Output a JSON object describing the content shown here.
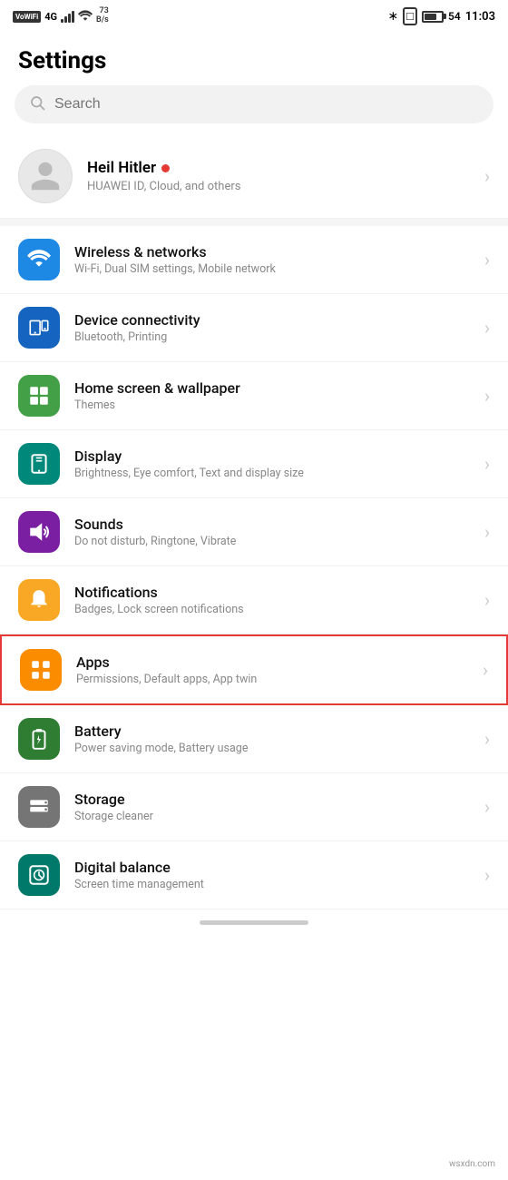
{
  "statusBar": {
    "left": {
      "vowifi": "VoWiFi",
      "network": "4G",
      "signal": "|||",
      "wifi": "WiFi",
      "speed": "73\nB/s"
    },
    "right": {
      "bluetooth": "BT",
      "vibrate": "📳",
      "battery": "54",
      "time": "11:03"
    }
  },
  "page": {
    "title": "Settings"
  },
  "search": {
    "placeholder": "Search"
  },
  "profile": {
    "name": "Heil Hitler",
    "subtitle": "HUAWEI ID, Cloud, and others"
  },
  "settingsItems": [
    {
      "id": "wireless",
      "iconColor": "icon-blue",
      "iconSymbol": "📶",
      "iconUnicode": "wifi",
      "title": "Wireless & networks",
      "subtitle": "Wi-Fi, Dual SIM settings, Mobile network",
      "highlighted": false
    },
    {
      "id": "device-connectivity",
      "iconColor": "icon-blue2",
      "iconSymbol": "🔗",
      "iconUnicode": "device",
      "title": "Device connectivity",
      "subtitle": "Bluetooth, Printing",
      "highlighted": false
    },
    {
      "id": "home-screen",
      "iconColor": "icon-green",
      "iconSymbol": "🖼",
      "iconUnicode": "home",
      "title": "Home screen & wallpaper",
      "subtitle": "Themes",
      "highlighted": false
    },
    {
      "id": "display",
      "iconColor": "icon-teal",
      "iconSymbol": "📱",
      "iconUnicode": "display",
      "title": "Display",
      "subtitle": "Brightness, Eye comfort, Text and display size",
      "highlighted": false
    },
    {
      "id": "sounds",
      "iconColor": "icon-purple",
      "iconSymbol": "🔊",
      "iconUnicode": "sounds",
      "title": "Sounds",
      "subtitle": "Do not disturb, Ringtone, Vibrate",
      "highlighted": false
    },
    {
      "id": "notifications",
      "iconColor": "icon-yellow",
      "iconSymbol": "🔔",
      "iconUnicode": "notifications",
      "title": "Notifications",
      "subtitle": "Badges, Lock screen notifications",
      "highlighted": false
    },
    {
      "id": "apps",
      "iconColor": "icon-orange",
      "iconSymbol": "⊞",
      "iconUnicode": "apps",
      "title": "Apps",
      "subtitle": "Permissions, Default apps, App twin",
      "highlighted": true
    },
    {
      "id": "battery",
      "iconColor": "icon-green2",
      "iconSymbol": "⚡",
      "iconUnicode": "battery",
      "title": "Battery",
      "subtitle": "Power saving mode, Battery usage",
      "highlighted": false
    },
    {
      "id": "storage",
      "iconColor": "icon-gray",
      "iconSymbol": "💾",
      "iconUnicode": "storage",
      "title": "Storage",
      "subtitle": "Storage cleaner",
      "highlighted": false
    },
    {
      "id": "digital-balance",
      "iconColor": "icon-teal2",
      "iconSymbol": "⏱",
      "iconUnicode": "digital-balance",
      "title": "Digital balance",
      "subtitle": "Screen time management",
      "highlighted": false
    }
  ],
  "watermark": "wsxdn.com"
}
